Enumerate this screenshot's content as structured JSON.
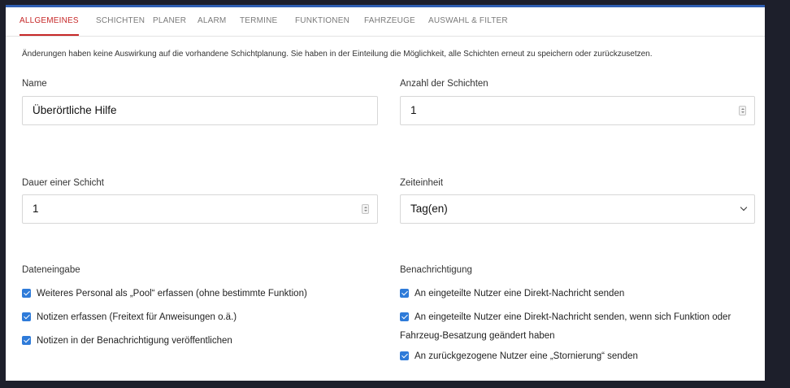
{
  "tabs": [
    {
      "label": "ALLGEMEINES",
      "active": true
    },
    {
      "label": "SCHICHTEN"
    },
    {
      "label": "PLANER"
    },
    {
      "label": "ALARM"
    },
    {
      "label": "TERMINE"
    },
    {
      "label": "FUNKTIONEN"
    },
    {
      "label": "FAHRZEUGE"
    },
    {
      "label": "AUSWAHL & FILTER"
    }
  ],
  "notice": "Änderungen haben keine Auswirkung auf die vorhandene Schichtplanung. Sie haben in der Einteilung die Möglichkeit, alle Schichten erneut zu speichern oder zurückzusetzen.",
  "name": {
    "label": "Name",
    "value": "Überörtliche Hilfe"
  },
  "shift_count": {
    "label": "Anzahl der Schichten",
    "value": "1"
  },
  "shift_duration": {
    "label": "Dauer einer Schicht",
    "value": "1"
  },
  "time_unit": {
    "label": "Zeiteinheit",
    "selected": "Tag(en)"
  },
  "data_entry": {
    "label": "Dateneingabe",
    "options": [
      {
        "label": "Weiteres Personal als „Pool“ erfassen (ohne bestimmte Funktion)",
        "checked": true
      },
      {
        "label": "Notizen erfassen (Freitext für Anweisungen o.ä.)",
        "checked": true
      },
      {
        "label": "Notizen in der Benachrichtigung veröffentlichen",
        "checked": true
      }
    ]
  },
  "notifications": {
    "label": "Benachrichtigung",
    "options": [
      {
        "label": "An eingeteilte Nutzer eine Direkt-Nachricht senden",
        "checked": true
      },
      {
        "label": "An eingeteilte Nutzer eine Direkt-Nachricht senden, wenn sich Funktion oder",
        "continuation": "Fahrzeug-Besatzung geändert haben",
        "checked": true
      },
      {
        "label": "An zurückgezogene Nutzer eine „Stornierung“ senden",
        "checked": true
      }
    ]
  },
  "colors": {
    "accent": "#c62828",
    "checkbox": "#2e7bd9",
    "top_bar": "#2f5fb3"
  }
}
